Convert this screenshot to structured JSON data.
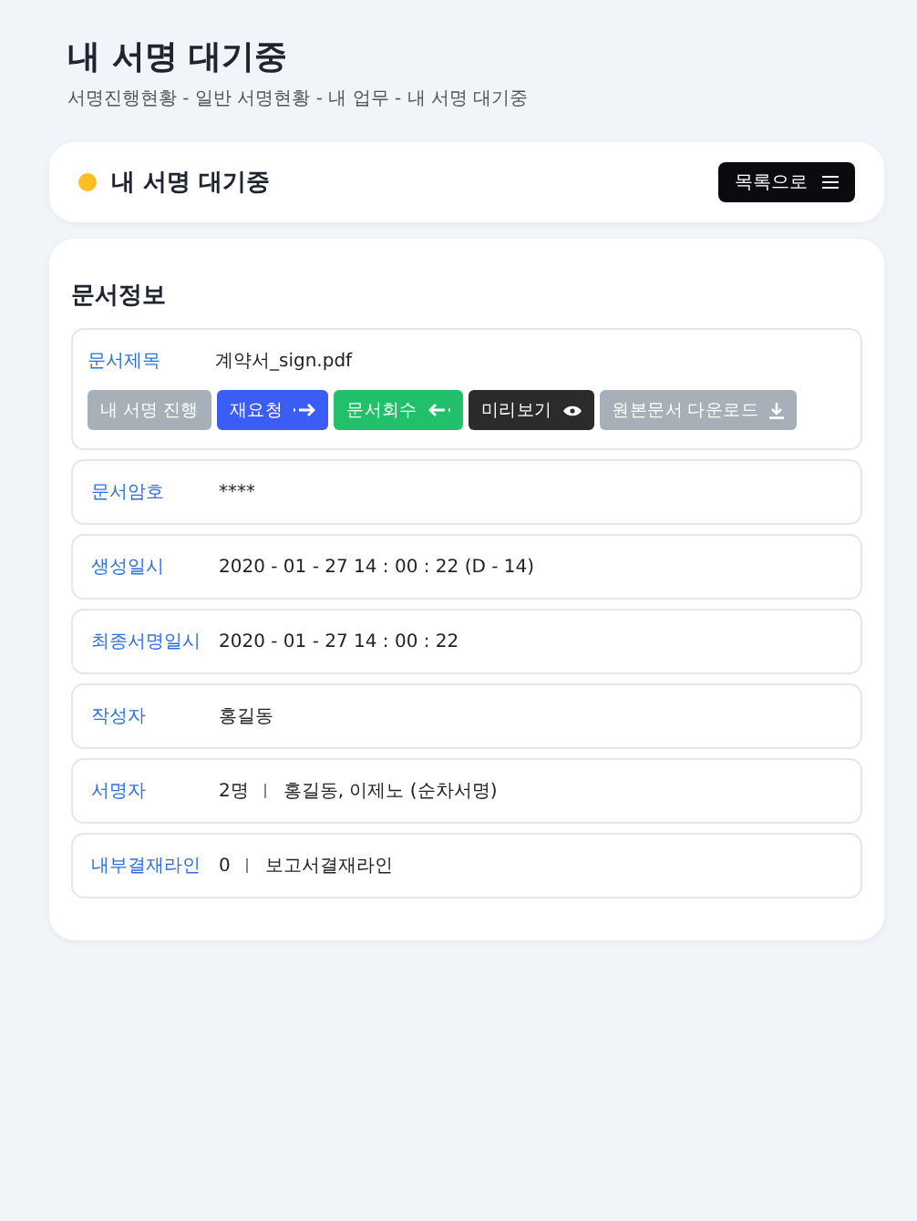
{
  "page_title": "내 서명 대기중",
  "breadcrumb": "서명진행현황 - 일반 서명현황 - 내 업무 - 내 서명 대기중",
  "status_card": {
    "color": "#fbbf24",
    "title": "내 서명 대기중",
    "list_button": "목록으로"
  },
  "section_title": "문서정보",
  "document_title": {
    "label": "문서제목",
    "value": "계약서_sign.pdf"
  },
  "actions": [
    {
      "kind": "progress",
      "label": "내 서명 진행"
    },
    {
      "kind": "request",
      "label": "재요청"
    },
    {
      "kind": "recall",
      "label": "문서회수"
    },
    {
      "kind": "preview",
      "label": "미리보기"
    },
    {
      "kind": "download",
      "label": "원본문서 다운로드"
    }
  ],
  "fields": [
    {
      "label": "문서암호",
      "values": [
        "****"
      ]
    },
    {
      "label": "생성일시",
      "values": [
        "2020 - 01 - 27 14 : 00 : 22 (D - 14)"
      ]
    },
    {
      "label": "최종서명일시",
      "values": [
        "2020 - 01 - 27 14 : 00 : 22"
      ]
    },
    {
      "label": "작성자",
      "values": [
        "홍길동"
      ]
    },
    {
      "label": "서명자",
      "values": [
        "2명",
        "홍길동, 이제노 (순차서명)"
      ]
    },
    {
      "label": "내부결재라인",
      "values": [
        "0",
        "보고서결재라인"
      ]
    }
  ]
}
